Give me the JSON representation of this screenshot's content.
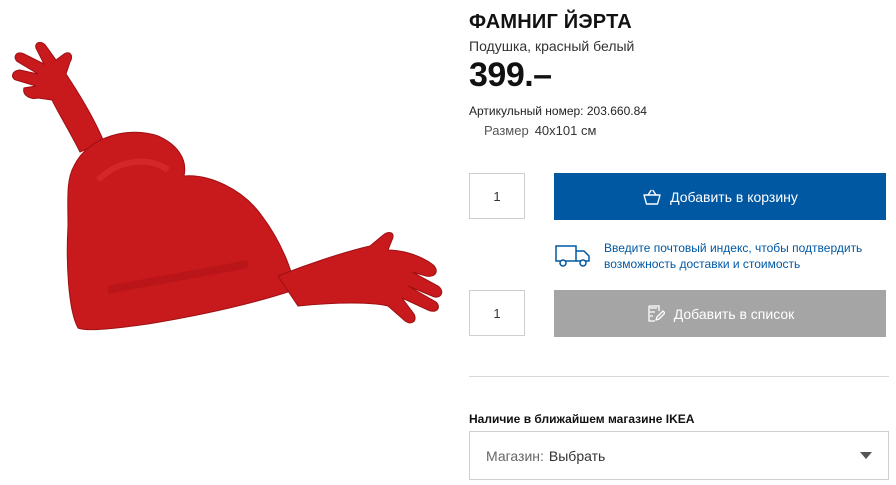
{
  "product": {
    "name": "ФАМНИГ ЙЭРТА",
    "description": "Подушка, красный белый",
    "price": "399.–",
    "article_label": "Артикульный номер:",
    "article_number": "203.660.84",
    "size_label": "Размер",
    "size_value": "40x101 см"
  },
  "cart": {
    "quantity": "1",
    "button_label": "Добавить в корзину",
    "icon": "shopping-bag-icon"
  },
  "delivery": {
    "icon": "delivery-truck-icon",
    "link_text": "Введите почтовый индекс, чтобы подтвердить возможность доставки и стоимость"
  },
  "wishlist": {
    "quantity": "1",
    "button_label": "Добавить в список",
    "icon": "edit-list-icon"
  },
  "store": {
    "heading": "Наличие в ближайшем магазине IKEA",
    "select_label": "Магазин:",
    "select_value": "Выбрать"
  },
  "colors": {
    "brand_blue": "#0058a3",
    "disabled_gray": "#a5a5a5",
    "pillow_red": "#c8191c"
  }
}
